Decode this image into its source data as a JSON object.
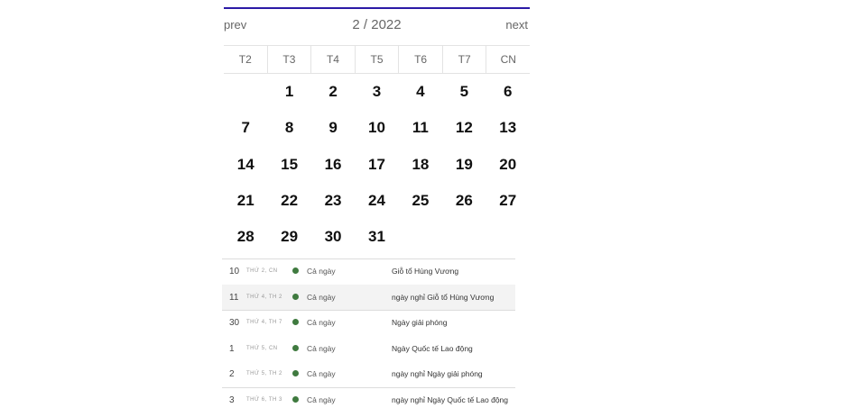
{
  "nav": {
    "prev_label": "prev",
    "next_label": "next",
    "title": "2 / 2022"
  },
  "weekdays": [
    "T2",
    "T3",
    "T4",
    "T5",
    "T6",
    "T7",
    "CN"
  ],
  "days": [
    "",
    "1",
    "2",
    "3",
    "4",
    "5",
    "6",
    "7",
    "8",
    "9",
    "10",
    "11",
    "12",
    "13",
    "14",
    "15",
    "16",
    "17",
    "18",
    "19",
    "20",
    "21",
    "22",
    "23",
    "24",
    "25",
    "26",
    "27",
    "28",
    "29",
    "30",
    "31",
    "",
    "",
    ""
  ],
  "events": [
    {
      "day": "10",
      "sub": "THỨ 2, CN",
      "allday": "Cả ngày",
      "name": "Giỗ tổ Hùng Vương",
      "sep": true,
      "hl": false
    },
    {
      "day": "11",
      "sub": "THỨ 4, TH 2",
      "allday": "Cả ngày",
      "name": "ngày nghỉ Giỗ tổ Hùng Vương",
      "sep": false,
      "hl": true
    },
    {
      "day": "30",
      "sub": "THỨ 4, TH 7",
      "allday": "Cả ngày",
      "name": "Ngày giải phóng",
      "sep": true,
      "hl": false
    },
    {
      "day": "1",
      "sub": "THỨ 5, CN",
      "allday": "Cả ngày",
      "name": "Ngày Quốc tế Lao động",
      "sep": false,
      "hl": false
    },
    {
      "day": "2",
      "sub": "THỨ 5, TH 2",
      "allday": "Cả ngày",
      "name": "ngày nghỉ Ngày giải phóng",
      "sep": false,
      "hl": false
    },
    {
      "day": "3",
      "sub": "THỨ 6, TH 3",
      "allday": "Cả ngày",
      "name": "ngày nghỉ Ngày Quốc tế Lao động",
      "sep": true,
      "hl": false
    }
  ],
  "colors": {
    "accent": "#2b1aa6",
    "event_dot": "#3f7a3f"
  }
}
